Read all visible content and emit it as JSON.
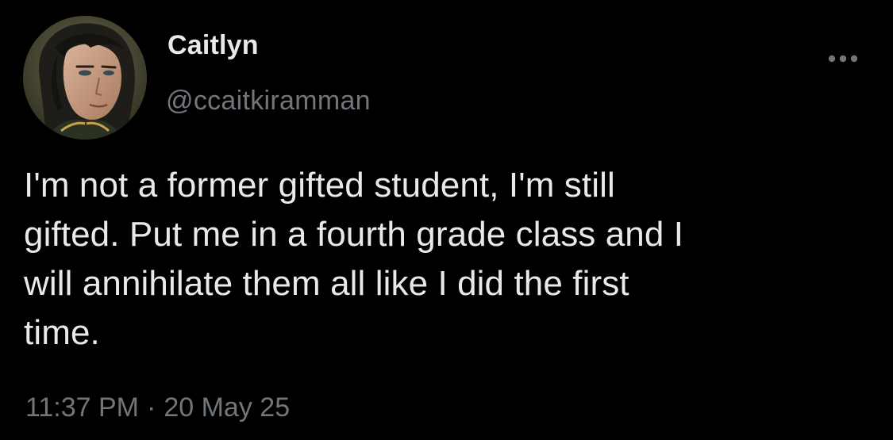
{
  "tweet": {
    "author": {
      "display_name": "Caitlyn",
      "handle": "@ccaitkiramman"
    },
    "text": "I'm not a former gifted student, I'm still\ngifted. Put me in a fourth grade class and I\nwill annihilate them all like I did the first\ntime.",
    "time": "11:37 PM",
    "separator": "·",
    "date": "20 May 25",
    "more_icon": "more-horizontal-icon"
  },
  "colors": {
    "background": "#000000",
    "primary_text": "#e7e9ea",
    "secondary_text": "#71767b"
  }
}
